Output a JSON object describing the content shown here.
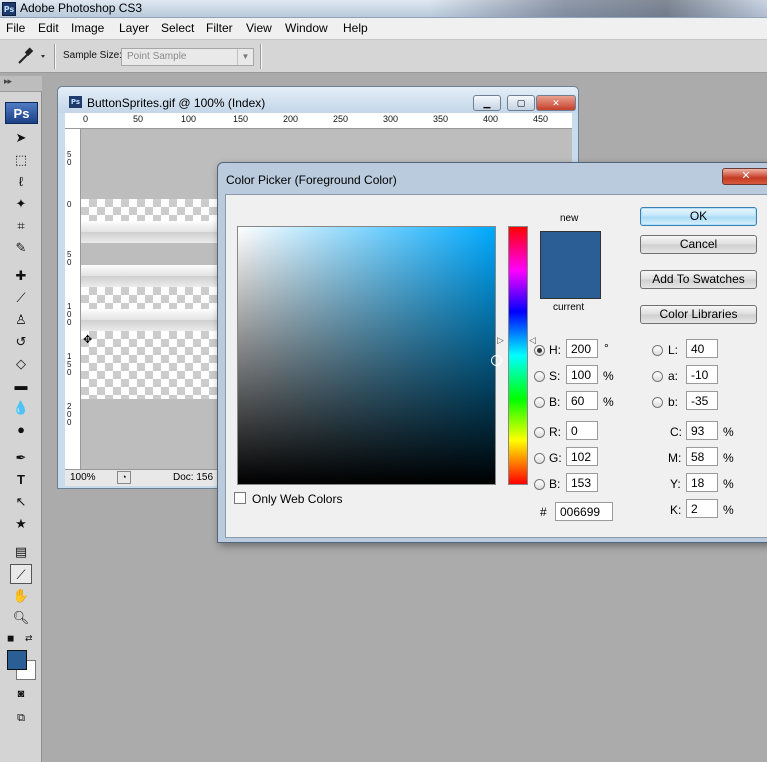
{
  "app": {
    "title": "Adobe Photoshop CS3",
    "badge": "Ps"
  },
  "menu": [
    "File",
    "Edit",
    "Image",
    "Layer",
    "Select",
    "Filter",
    "View",
    "Window",
    "Help"
  ],
  "options": {
    "sample_size_label": "Sample Size:",
    "sample_size_value": "Point Sample",
    "tool_icon": "eyedropper-icon"
  },
  "tools": {
    "logo": "Ps",
    "icons": [
      "move-icon",
      "marquee-icon",
      "lasso-icon",
      "magic-wand-icon",
      "crop-icon",
      "slice-icon",
      "healing-icon",
      "brush-icon",
      "stamp-icon",
      "history-brush-icon",
      "eraser-icon",
      "gradient-icon",
      "blur-icon",
      "dodge-icon",
      "pen-icon",
      "type-icon",
      "path-select-icon",
      "shape-icon",
      "notes-icon",
      "eyedropper-icon",
      "hand-icon",
      "zoom-icon"
    ],
    "foreground_color": "#2a5e94",
    "background_color": "#ffffff"
  },
  "document": {
    "title": "ButtonSprites.gif @ 100% (Index)",
    "ruler_h": [
      "0",
      "50",
      "100",
      "150",
      "200",
      "250",
      "300",
      "350",
      "400",
      "450"
    ],
    "ruler_v": [
      "5 0",
      "0",
      "5 0",
      "1 0 0",
      "1 5 0",
      "2 0 0"
    ],
    "zoom": "100%",
    "doc_info": "Doc: 156"
  },
  "color_picker": {
    "title": "Color Picker (Foreground Color)",
    "new_label": "new",
    "current_label": "current",
    "preview_color": "#2a5e94",
    "buttons": {
      "ok": "OK",
      "cancel": "Cancel",
      "add_to_swatches": "Add To Swatches",
      "color_libraries": "Color Libraries"
    },
    "only_web_colors": "Only Web Colors",
    "hsb": {
      "h_label": "H:",
      "h": "200",
      "h_unit": "°",
      "s_label": "S:",
      "s": "100",
      "s_unit": "%",
      "b_label": "B:",
      "b": "60",
      "b_unit": "%"
    },
    "rgb": {
      "r_label": "R:",
      "r": "0",
      "g_label": "G:",
      "g": "102",
      "b_label": "B:",
      "b": "153"
    },
    "lab": {
      "l_label": "L:",
      "l": "40",
      "a_label": "a:",
      "a": "-10",
      "b_label": "b:",
      "b": "-35"
    },
    "cmyk": {
      "c_label": "C:",
      "c": "93",
      "m_label": "M:",
      "m": "58",
      "y_label": "Y:",
      "y": "18",
      "k_label": "K:",
      "k": "2",
      "unit": "%"
    },
    "hex_label": "#",
    "hex": "006699",
    "selected_mode": "H"
  }
}
